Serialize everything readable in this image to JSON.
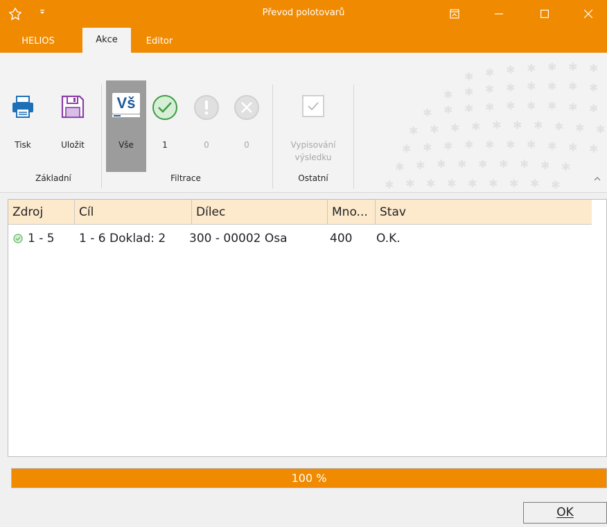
{
  "window": {
    "title": "Převod polotovarů"
  },
  "tabs": [
    {
      "label": "HELIOS"
    },
    {
      "label": "Akce"
    },
    {
      "label": "Editor"
    }
  ],
  "ribbon": {
    "groups": [
      {
        "label": "Základní"
      },
      {
        "label": "Filtrace"
      },
      {
        "label": "Ostatní"
      }
    ],
    "buttons": {
      "tisk": "Tisk",
      "ulozit": "Uložit",
      "vse": "Vše",
      "vse_badge": "Vš",
      "ok_count": "1",
      "warning_count": "0",
      "error_count": "0",
      "vypisovani_line1": "Vypisování",
      "vypisovani_line2": "výsledku"
    }
  },
  "grid": {
    "columns": [
      "Zdroj",
      "Cíl",
      "Dílec",
      "Mno...",
      "Stav"
    ],
    "rows": [
      {
        "zdroj": "1 - 5",
        "cil": "1 - 6 Doklad: 2",
        "dilec": "300 - 00002 Osa",
        "mnozstvi": "400",
        "stav": "O.K.",
        "status_icon": "check-circle-icon"
      }
    ]
  },
  "progress": {
    "value_percent": 100,
    "text": "100 %"
  },
  "footer": {
    "ok_label": "OK"
  },
  "colors": {
    "accent": "#f08a00",
    "header_bg": "#fde9cc",
    "success_green": "#5bb85d"
  }
}
